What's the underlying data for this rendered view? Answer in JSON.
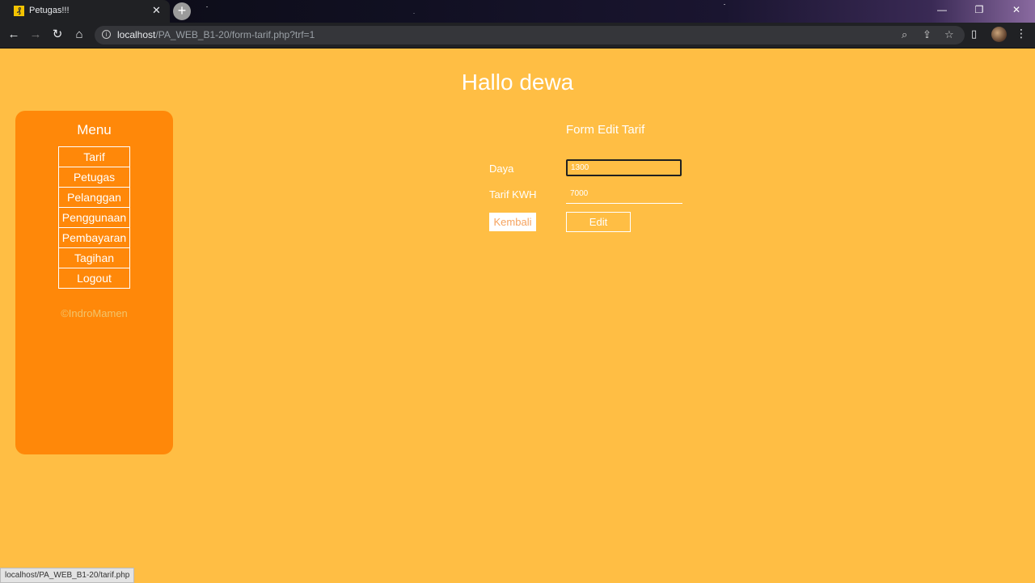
{
  "browser": {
    "tab_title": "Petugas!!!",
    "favicon_glyph": "₰",
    "url_host": "localhost",
    "url_path": "/PA_WEB_B1-20/form-tarif.php?trf=1",
    "status_url": "localhost/PA_WEB_B1-20/tarif.php"
  },
  "page": {
    "greeting": "Hallo dewa"
  },
  "sidebar": {
    "title": "Menu",
    "items": [
      {
        "label": "Tarif"
      },
      {
        "label": "Petugas"
      },
      {
        "label": "Pelanggan"
      },
      {
        "label": "Penggunaan"
      },
      {
        "label": "Pembayaran"
      },
      {
        "label": "Tagihan"
      },
      {
        "label": "Logout"
      }
    ],
    "copyright": "©IndroMamen"
  },
  "form": {
    "title": "Form Edit Tarif",
    "daya_label": "Daya",
    "daya_value": "1300",
    "tarif_label": "Tarif KWH",
    "tarif_value": "7000",
    "back_label": "Kembali",
    "submit_label": "Edit"
  },
  "colors": {
    "page_bg": "#ffbe44",
    "sidebar_bg": "#ff8809"
  }
}
